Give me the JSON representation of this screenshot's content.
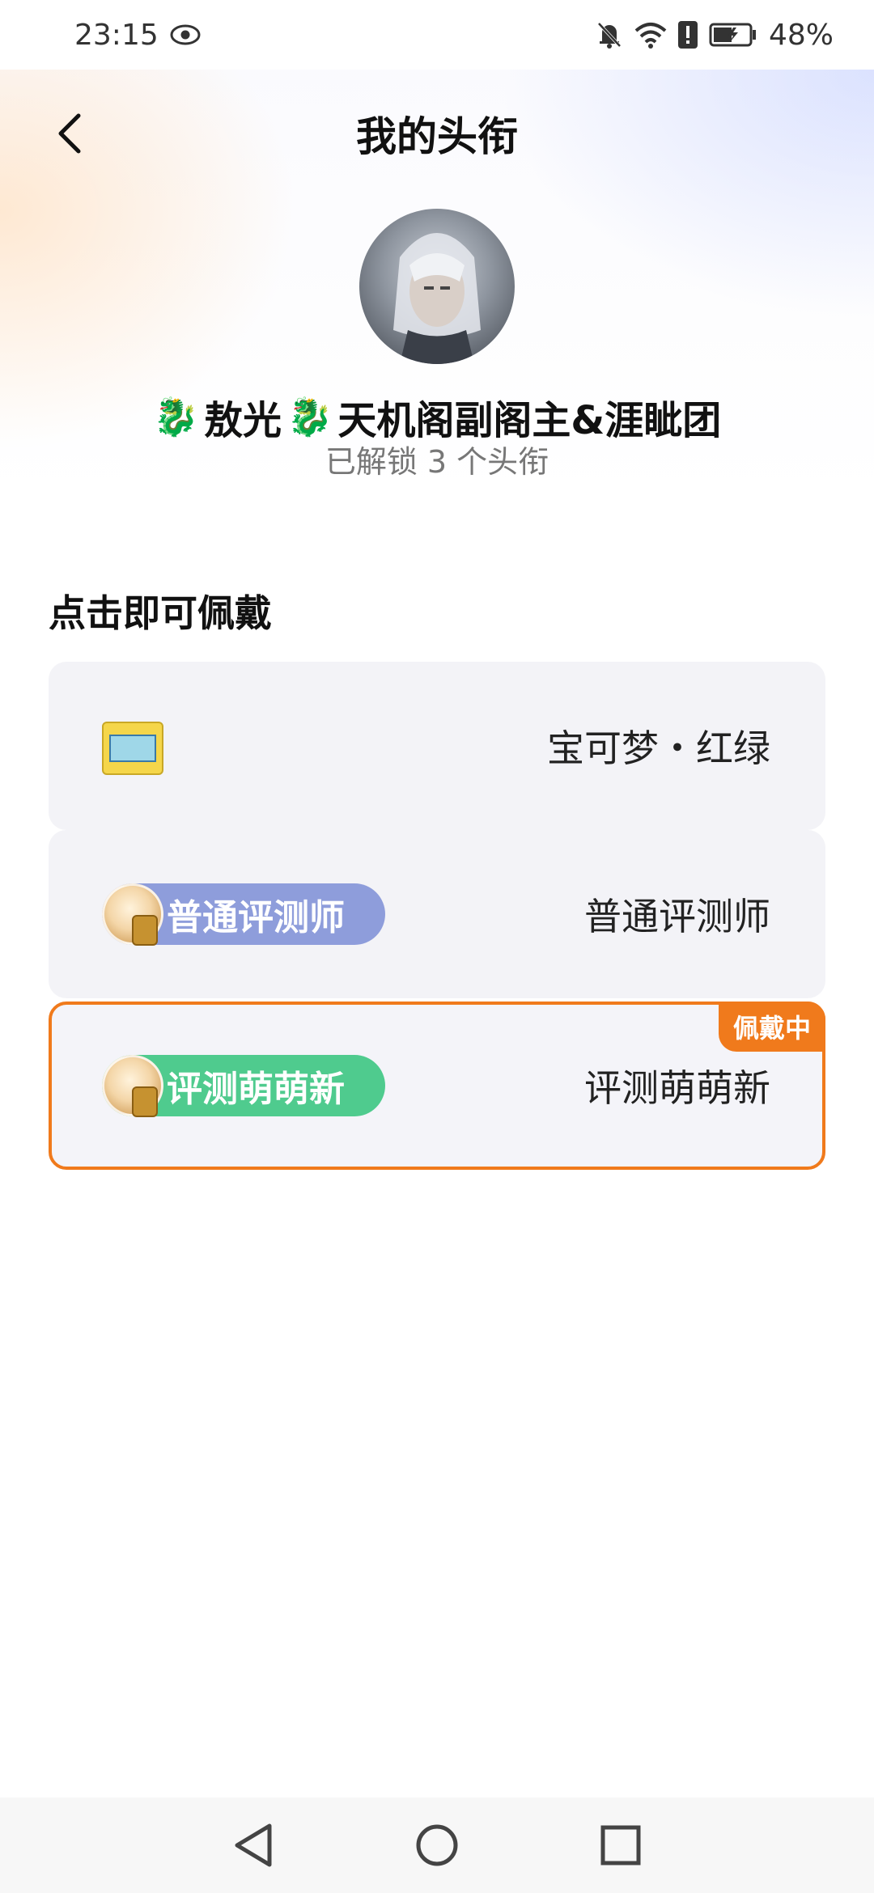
{
  "status_bar": {
    "time": "23:15",
    "battery": "48%",
    "icons": [
      "eye-icon",
      "bell-off-icon",
      "wifi-icon",
      "alert-icon",
      "battery-icon"
    ]
  },
  "header": {
    "title": "我的头衔",
    "back_icon": "chevron-left-icon"
  },
  "profile": {
    "name_part1": "敖光",
    "name_part2": "天机阁副阁主&涯眦团",
    "dragon_glyph": "🐉",
    "unlock_text": "已解锁 3 个头衔"
  },
  "section": {
    "title": "点击即可佩戴"
  },
  "titles": [
    {
      "name": "宝可梦・红绿",
      "badge_type": "pokemon-badge-icon",
      "wearing": false
    },
    {
      "name": "普通评测师",
      "badge_label": "普通评测师",
      "badge_color": "#8e9ddb",
      "wearing": false
    },
    {
      "name": "评测萌萌新",
      "badge_label": "评测萌萌新",
      "badge_color": "#4fcb8e",
      "wearing": true,
      "wearing_label": "佩戴中"
    }
  ],
  "colors": {
    "accent": "#f07a1c",
    "card_bg": "#f3f3f7"
  },
  "nav_bar": {
    "icons": [
      "back-triangle-icon",
      "home-circle-icon",
      "recents-square-icon"
    ]
  }
}
